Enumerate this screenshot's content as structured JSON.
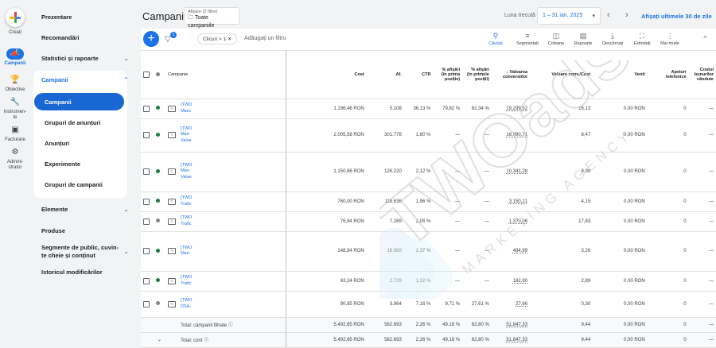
{
  "rail": [
    {
      "label": "Creați"
    },
    {
      "label": "Campanii",
      "active": true
    },
    {
      "label": "Obiective"
    },
    {
      "label": "Instrumen-\nte"
    },
    {
      "label": "Facturare"
    },
    {
      "label": "Admini-\nstrator"
    }
  ],
  "nav": {
    "prezentare": "Prezentare",
    "recomandari": "Recomandări",
    "statistici": "Statistici și rapoarte",
    "campanii_group": "Campanii",
    "sub": [
      "Campanii",
      "Grupuri de anunțuri",
      "Anunțuri",
      "Experimente",
      "Grupuri de campanii"
    ],
    "elemente": "Elemente",
    "produse": "Produse",
    "segmente": "Segmente de public, cuvin-\nte cheie și conținut",
    "istoric": "Istoricul modificărilor"
  },
  "header": {
    "title": "Campanii",
    "filter_top": "Afișare (2 filtre)",
    "filter_main": "Toate campaniile",
    "range_label": "Luna trecută",
    "range_value": "1 – 31 ian. 2025",
    "last30": "Afișați ultimele 30 de zile"
  },
  "toolbar": {
    "badge": "1",
    "chip": "Clicuri > 1",
    "add_filter": "Adăugați un filtru",
    "tools": [
      "Căutați",
      "Segmentați",
      "Coloane",
      "Rapoarte",
      "Descărcați",
      "Extindeți",
      "Mai multe"
    ]
  },
  "columns": [
    "Campanie",
    "Cost",
    "Af.",
    "CTR",
    "% afișări (în prima poziție)",
    "% afișări (în primele poziții)",
    "Valoarea conversiilor",
    "Valoare conv./Cost",
    "Venit",
    "Apeluri telefonice",
    "Costul bunurilor vândute"
  ],
  "rows": [
    {
      "status": "g",
      "name": "[TWO\nMaxc",
      "cost": "1.196,46 RON",
      "af": "5.108",
      "ctr": "36,13 %",
      "p1": "79,82 %",
      "p2": "82,34 %",
      "vc": "19.299,52",
      "vcc": "16,13",
      "venit": "0,00 RON",
      "apel": "0",
      "cbv": "—"
    },
    {
      "status": "g",
      "name": "[TWO\nMax-\nValue",
      "cost": "2.005,58 RON",
      "af": "301.778",
      "ctr": "1,80 %",
      "p1": "—",
      "p2": "—",
      "vc": "16.990,71",
      "vcc": "8,47",
      "venit": "0,00 RON",
      "apel": "0",
      "cbv": "—"
    },
    {
      "status": "g",
      "name": "[TWO\nMax-\nValue",
      "cost": "1.150,86 RON",
      "af": "126.220",
      "ctr": "2,12 %",
      "p1": "—",
      "p2": "—",
      "vc": "10.341,28",
      "vcc": "8,99",
      "venit": "0,00 RON",
      "apel": "0",
      "cbv": "—"
    },
    {
      "status": "g",
      "name": "[TWO\nTrafic",
      "cost": "760,00 RON",
      "af": "118.636",
      "ctr": "1,96 %",
      "p1": "—",
      "p2": "—",
      "vc": "3.150,21",
      "vcc": "4,15",
      "venit": "0,00 RON",
      "apel": "0",
      "cbv": "—"
    },
    {
      "status": "gr",
      "name": "[TWO\nTrafic",
      "cost": "76,84 RON",
      "af": "7.269",
      "ctr": "2,05 %",
      "p1": "—",
      "p2": "—",
      "vc": "1.370,06",
      "vcc": "17,83",
      "venit": "0,00 RON",
      "apel": "0",
      "cbv": "—"
    },
    {
      "status": "g",
      "name": "[TWO\nMax-",
      "cost": "148,84 RON",
      "af": "16.989",
      "ctr": "2,37 %",
      "p1": "—",
      "p2": "—",
      "vc": "484,99",
      "vcc": "3,26",
      "venit": "0,00 RON",
      "apel": "0",
      "cbv": "—"
    },
    {
      "status": "g",
      "name": "[TWO\nTrafic",
      "cost": "63,24 RON",
      "af": "2.729",
      "ctr": "1,32 %",
      "p1": "—",
      "p2": "—",
      "vc": "182,90",
      "vcc": "2,89",
      "venit": "0,00 RON",
      "apel": "0",
      "cbv": "—"
    },
    {
      "status": "gr",
      "name": "[TWO\nDSA-",
      "cost": "90,85 RON",
      "af": "3.964",
      "ctr": "7,16 %",
      "p1": "9,71 %",
      "p2": "27,61 %",
      "vc": "27,66",
      "vcc": "0,30",
      "venit": "0,00 RON",
      "apel": "0",
      "cbv": "—"
    }
  ],
  "totals": [
    {
      "label": "Total: campanii filtrate",
      "cost": "5.492,65 RON",
      "af": "582.693",
      "ctr": "2,26 %",
      "p1": "49,18 %",
      "p2": "62,80 %",
      "vc": "51.847,33",
      "vcc": "9,44",
      "venit": "0,00 RON",
      "apel": "0",
      "cbv": "—"
    },
    {
      "label": "Total: cont",
      "cost": "5.492,65 RON",
      "af": "582.693",
      "ctr": "2,26 %",
      "p1": "49,18 %",
      "p2": "62,80 %",
      "vc": "51.847,33",
      "vcc": "9,44",
      "venit": "0,00 RON",
      "apel": "0",
      "cbv": "—"
    }
  ],
  "watermark": {
    "brand": "TWOads",
    "tagline": "MARKETING AGENCY"
  }
}
